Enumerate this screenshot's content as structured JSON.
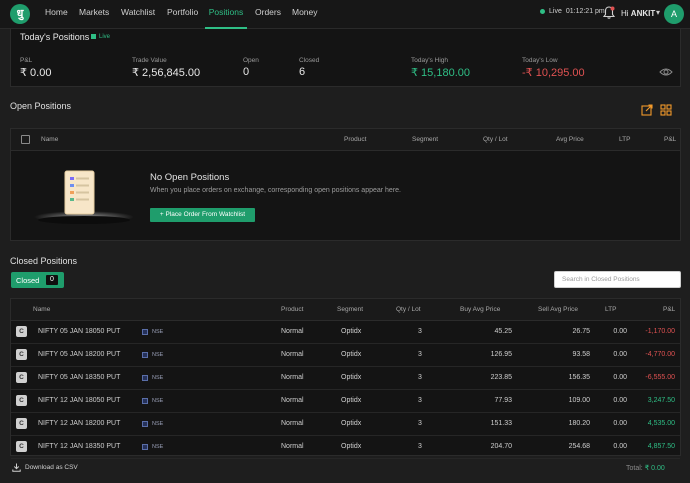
{
  "nav": {
    "logo": "धु",
    "items": [
      "Home",
      "Markets",
      "Watchlist",
      "Portfolio",
      "Positions",
      "Orders",
      "Money"
    ],
    "active": "Positions",
    "status_live": "Live",
    "time": "01:12:21 pm",
    "greeting": "Hi",
    "username": "ANKIT",
    "avatar": "A"
  },
  "summary": {
    "title": "Today's Positions",
    "live": "Live",
    "stats": [
      {
        "label": "P&L",
        "value": "₹ 0.00",
        "tone": "normal"
      },
      {
        "label": "Trade Value",
        "value": "₹ 2,56,845.00",
        "tone": "normal"
      },
      {
        "label": "Open",
        "value": "0",
        "tone": "normal"
      },
      {
        "label": "Closed",
        "value": "6",
        "tone": "normal"
      },
      {
        "label": "Today's High",
        "value": "₹ 15,180.00",
        "tone": "green"
      },
      {
        "label": "Today's Low",
        "value": "-₹ 10,295.00",
        "tone": "red"
      }
    ]
  },
  "open": {
    "title": "Open Positions",
    "headers": [
      "Name",
      "Product",
      "Segment",
      "Qty / Lot",
      "Avg Price",
      "LTP",
      "P&L"
    ],
    "empty_title": "No Open Positions",
    "empty_desc": "When you place orders on exchange, corresponding open positions appear here.",
    "button": "+ Place Order From Watchlist"
  },
  "closed": {
    "title": "Closed Positions",
    "tab_label": "Closed",
    "tab_count": "0",
    "search_placeholder": "Search in Closed Positions",
    "headers": [
      "Name",
      "Product",
      "Segment",
      "Qty / Lot",
      "Buy Avg Price",
      "Sell Avg Price",
      "LTP",
      "P&L"
    ],
    "badge": "C",
    "exchange": "NSE",
    "rows": [
      {
        "name": "NIFTY 05 JAN 18050 PUT",
        "product": "Normal",
        "segment": "Optidx",
        "qty": "3",
        "buy": "45.25",
        "sell": "26.75",
        "ltp": "0.00",
        "pnl": "-1,170.00",
        "tone": "red"
      },
      {
        "name": "NIFTY 05 JAN 18200 PUT",
        "product": "Normal",
        "segment": "Optidx",
        "qty": "3",
        "buy": "126.95",
        "sell": "93.58",
        "ltp": "0.00",
        "pnl": "-4,770.00",
        "tone": "red"
      },
      {
        "name": "NIFTY 05 JAN 18350 PUT",
        "product": "Normal",
        "segment": "Optidx",
        "qty": "3",
        "buy": "223.85",
        "sell": "156.35",
        "ltp": "0.00",
        "pnl": "-6,555.00",
        "tone": "red"
      },
      {
        "name": "NIFTY 12 JAN 18050 PUT",
        "product": "Normal",
        "segment": "Optidx",
        "qty": "3",
        "buy": "77.93",
        "sell": "109.00",
        "ltp": "0.00",
        "pnl": "3,247.50",
        "tone": "green"
      },
      {
        "name": "NIFTY 12 JAN 18200 PUT",
        "product": "Normal",
        "segment": "Optidx",
        "qty": "3",
        "buy": "151.33",
        "sell": "180.20",
        "ltp": "0.00",
        "pnl": "4,535.00",
        "tone": "green"
      },
      {
        "name": "NIFTY 12 JAN 18350 PUT",
        "product": "Normal",
        "segment": "Optidx",
        "qty": "3",
        "buy": "204.70",
        "sell": "254.68",
        "ltp": "0.00",
        "pnl": "4,857.50",
        "tone": "green"
      }
    ],
    "download": "Download as CSV",
    "total_label": "Total:",
    "total_value": "₹ 0.00"
  },
  "colors": {
    "accent": "#2fbf86",
    "negative": "#e05252",
    "button": "#1f9d6c",
    "icon_orange": "#f39a2b"
  }
}
